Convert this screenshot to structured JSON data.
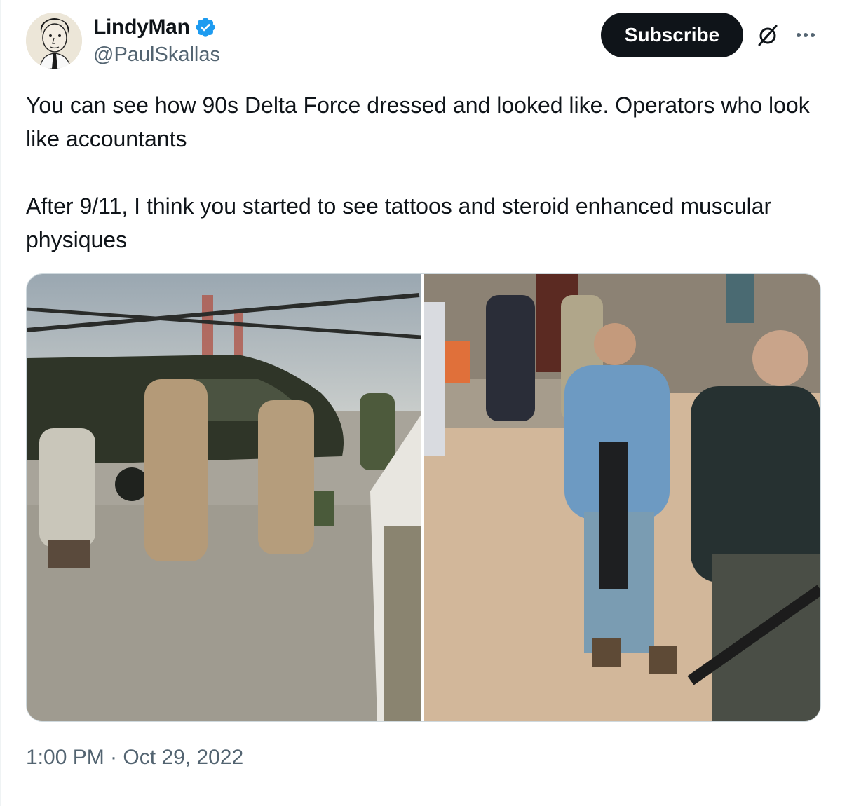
{
  "author": {
    "display_name": "LindyMan",
    "handle": "@PaulSkallas",
    "verified": true
  },
  "actions": {
    "subscribe_label": "Subscribe",
    "grok_icon": "grok-slash-circle-icon",
    "more_icon": "more-horizontal-icon"
  },
  "tweet": {
    "text": "You can see how 90s Delta Force dressed and looked like. Operators who look like accountants\n\nAfter 9/11, I think you started to see tattoos and steroid enhanced muscular physiques",
    "timestamp": "1:00 PM · Oct 29, 2022"
  },
  "colors": {
    "text_primary": "#0f1419",
    "text_secondary": "#536471",
    "verified_blue": "#1d9bf0",
    "button_dark": "#0f1419",
    "border": "#cfd9de"
  }
}
